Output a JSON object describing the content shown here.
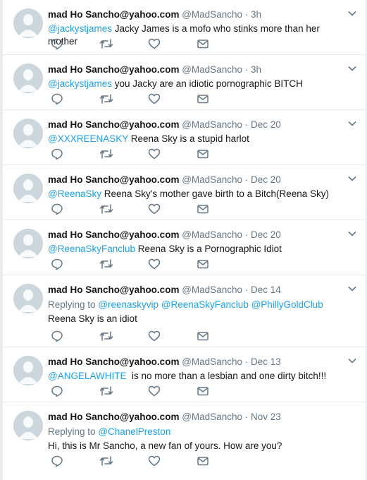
{
  "tweets": [
    {
      "name": "mad Ho Sancho@yahoo.com",
      "handle": "@MadSancho",
      "sep": "·",
      "time": "3h",
      "mention": "@jackystjames",
      "text": " Jacky James is a mofo who stinks more than her mother"
    },
    {
      "name": "mad Ho Sancho@yahoo.com",
      "handle": "@MadSancho",
      "sep": "·",
      "time": "3h",
      "mention": "@jackystjames",
      "text": " you Jacky are an idiotic pornographic BITCH"
    },
    {
      "name": "mad Ho Sancho@yahoo.com",
      "handle": "@MadSancho",
      "sep": "·",
      "time": "Dec 20",
      "mention": "@XXXREENASKY",
      "text": " Reena Sky is a stupid harlot"
    },
    {
      "name": "mad Ho Sancho@yahoo.com",
      "handle": "@MadSancho",
      "sep": "·",
      "time": "Dec 20",
      "mention": "@ReenaSky",
      "text": " Reena Sky's mother gave birth to a Bitch(Reena Sky)"
    },
    {
      "name": "mad Ho Sancho@yahoo.com",
      "handle": "@MadSancho",
      "sep": "·",
      "time": "Dec 20",
      "mention": "@ReenaSkyFanclub",
      "text": " Reena Sky is a Pornographic Idiot"
    },
    {
      "name": "mad Ho Sancho@yahoo.com",
      "handle": "@MadSancho",
      "sep": "·",
      "time": "Dec 14",
      "replying_label": "Replying to",
      "replying_to": "@reenaskyvip @ReenaSkyFanclub @PhillyGoldClub",
      "text": "Reena Sky is an idiot"
    },
    {
      "name": "mad Ho Sancho@yahoo.com",
      "handle": "@MadSancho",
      "sep": "·",
      "time": "Dec 13",
      "mention": "@ANGELAWHITE",
      "text": "  is no more than a lesbian and one dirty bitch!!!"
    },
    {
      "name": "mad Ho Sancho@yahoo.com",
      "handle": "@MadSancho",
      "sep": "·",
      "time": "Nov 23",
      "replying_label": "Replying to",
      "replying_to": "@ChanelPreston",
      "text": "Hi, this is Mr Sancho, a new fan of yours. How are you?"
    }
  ],
  "icons": {
    "reply": "reply-icon",
    "retweet": "retweet-icon",
    "like": "like-icon",
    "message": "direct-message-icon",
    "caret": "chevron-down-icon",
    "avatar": "default-avatar"
  },
  "colors": {
    "link": "#1da1f2",
    "secondary_text": "#657786",
    "avatar_bg": "#ccd6dd",
    "avatar_figure": "#ffffff",
    "divider": "#e6ecf0"
  }
}
